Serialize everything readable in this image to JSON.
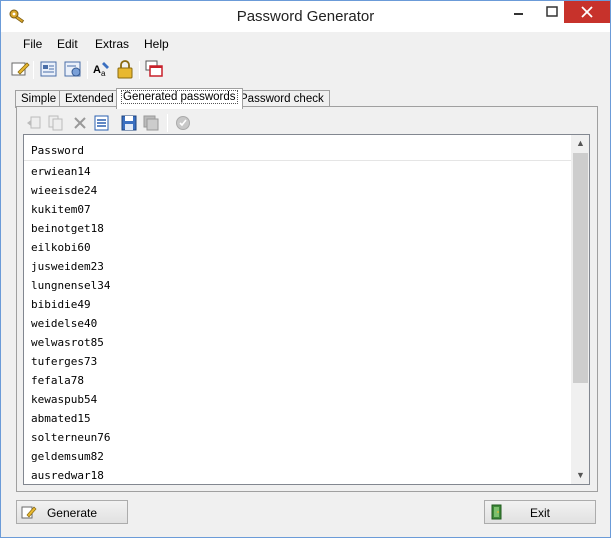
{
  "window": {
    "title": "Password Generator"
  },
  "menu": [
    "File",
    "Edit",
    "Extras",
    "Help"
  ],
  "toolbar_icons": [
    "new-profile-icon",
    "export-icon",
    "import-icon",
    "font-icon",
    "lock-icon",
    "windows-icon"
  ],
  "tabs": [
    {
      "label": "Simple",
      "active": false
    },
    {
      "label": "Extended",
      "active": false
    },
    {
      "label": "Generated passwords",
      "active": true
    },
    {
      "label": "Password check",
      "active": false
    }
  ],
  "subtoolbar_icons": [
    "insert-icon",
    "copy-icon",
    "delete-icon",
    "list-icon",
    "save-icon",
    "save-all-icon",
    "check-icon"
  ],
  "list": {
    "header": "Password",
    "rows": [
      "erwiean14",
      "wieeisde24",
      "kukitem07",
      "beinotget18",
      "eilkobi60",
      "jusweidem23",
      "lungnensel34",
      "bibidie49",
      "weidelse40",
      "welwasrot85",
      "tuferges73",
      "fefala78",
      "kewaspub54",
      "abmated15",
      "solterneun76",
      "geldemsum82",
      "ausredwar18"
    ]
  },
  "buttons": {
    "generate": "Generate",
    "exit": "Exit"
  },
  "colors": {
    "close_button": "#c7322b",
    "window_border": "#6b9bd8"
  }
}
